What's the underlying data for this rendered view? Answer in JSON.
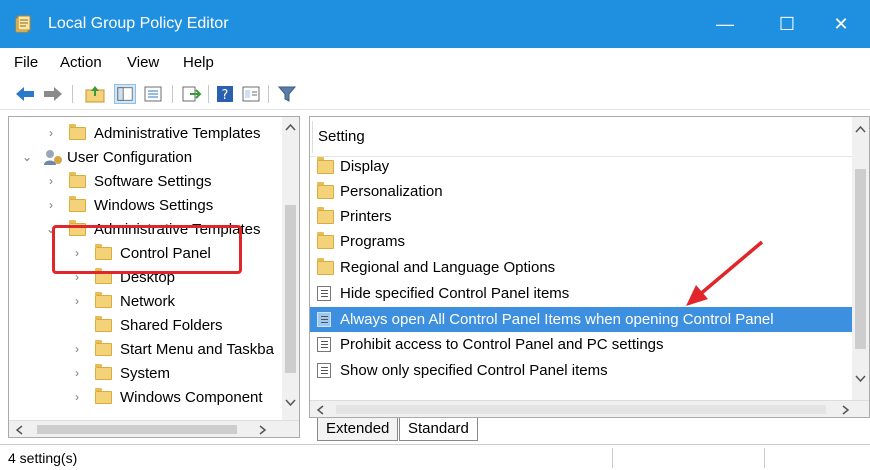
{
  "window": {
    "title": "Local Group Policy Editor",
    "minimize_glyph": "—",
    "maximize_glyph": "☐",
    "close_glyph": "✕",
    "accent_color": "#1f8fe0"
  },
  "menu": {
    "items": [
      {
        "label": "File"
      },
      {
        "label": "Action"
      },
      {
        "label": "View"
      },
      {
        "label": "Help"
      }
    ]
  },
  "toolbar": {
    "buttons": [
      {
        "icon": "back-arrow-icon"
      },
      {
        "icon": "forward-arrow-icon"
      },
      {
        "icon": "up-folder-icon"
      },
      {
        "icon": "show-hide-tree-icon"
      },
      {
        "icon": "export-list-icon"
      },
      {
        "icon": "help-icon"
      },
      {
        "icon": "properties-icon"
      },
      {
        "icon": "filter-icon"
      }
    ]
  },
  "tree": {
    "items": [
      {
        "label": "Administrative Templates",
        "chevron": "›",
        "icon": "folder"
      },
      {
        "label": "User Configuration",
        "chevron": "⌄",
        "icon": "user-config"
      },
      {
        "label": "Software Settings",
        "chevron": "›",
        "icon": "folder"
      },
      {
        "label": "Windows Settings",
        "chevron": "›",
        "icon": "folder"
      },
      {
        "label": "Administrative Templates",
        "chevron": "⌄",
        "icon": "folder"
      },
      {
        "label": "Control Panel",
        "chevron": "›",
        "icon": "folder-open",
        "selected": true
      },
      {
        "label": "Desktop",
        "chevron": "›",
        "icon": "folder"
      },
      {
        "label": "Network",
        "chevron": "›",
        "icon": "folder"
      },
      {
        "label": "Shared Folders",
        "chevron": "",
        "icon": "folder"
      },
      {
        "label": "Start Menu and Taskba",
        "chevron": "›",
        "icon": "folder"
      },
      {
        "label": "System",
        "chevron": "›",
        "icon": "folder"
      },
      {
        "label": "Windows Component",
        "chevron": "›",
        "icon": "folder"
      }
    ]
  },
  "detail": {
    "column_header": "Setting",
    "rows": [
      {
        "label": "Display",
        "type": "folder"
      },
      {
        "label": "Personalization",
        "type": "folder"
      },
      {
        "label": "Printers",
        "type": "folder"
      },
      {
        "label": "Programs",
        "type": "folder"
      },
      {
        "label": "Regional and Language Options",
        "type": "folder"
      },
      {
        "label": "Hide specified Control Panel items",
        "type": "policy"
      },
      {
        "label": "Always open All Control Panel Items when opening Control Panel",
        "type": "policy",
        "selected": true
      },
      {
        "label": "Prohibit access to Control Panel and PC settings",
        "type": "policy"
      },
      {
        "label": "Show only specified Control Panel items",
        "type": "policy"
      }
    ]
  },
  "tabs": [
    {
      "label": "Extended",
      "active": false
    },
    {
      "label": "Standard",
      "active": true
    }
  ],
  "status": {
    "text": "4 setting(s)"
  },
  "annotation": {
    "color": "#e0262b"
  }
}
